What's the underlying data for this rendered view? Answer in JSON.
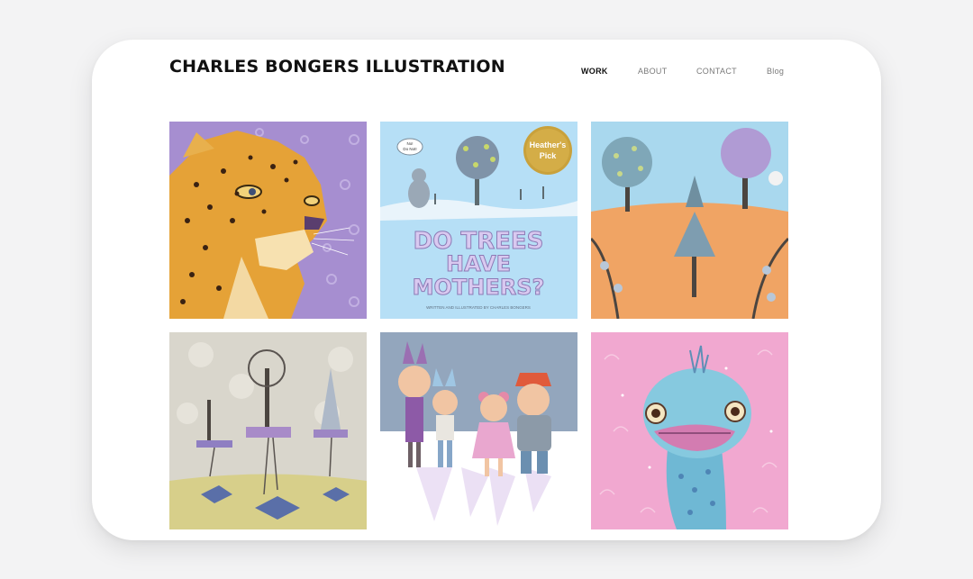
{
  "header": {
    "site_title": "CHARLES BONGERS ILLUSTRATION",
    "nav": [
      "WORK",
      "ABOUT",
      "CONTACT",
      "Blog"
    ],
    "active_nav": "WORK"
  },
  "gallery": {
    "items": [
      {
        "subject": "leopard",
        "background": "#a68ed0"
      },
      {
        "subject": "book-cover",
        "background": "#b6dff6",
        "cover_lines": [
          "DO TREES",
          "HAVE",
          "MOTHERS?"
        ],
        "cover_credit": "WRITTEN AND ILLUSTRATED BY CHARLES BONGERS",
        "badge": [
          "Heather's",
          "Pick"
        ],
        "speech": [
          "No!",
          "Do Not!"
        ]
      },
      {
        "subject": "trees-landscape",
        "background": "#a9d8ee"
      },
      {
        "subject": "floating-trees",
        "background": "#d9d6cc"
      },
      {
        "subject": "children-characters",
        "background": "#93a6bd"
      },
      {
        "subject": "ostrich",
        "background": "#f1a8d0"
      }
    ]
  },
  "colors": {
    "accent": "#111111",
    "nav_inactive": "#7a7a7a",
    "frame": "#ffffff",
    "page": "#f3f3f4"
  }
}
